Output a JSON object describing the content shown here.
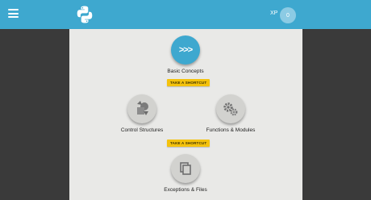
{
  "header": {
    "xp_label": "XP",
    "xp_value": "0"
  },
  "lessons": [
    {
      "label": "Basic Concepts",
      "icon": ">>>",
      "state": "active"
    },
    {
      "label": "Control Structures",
      "icon": "shapes-icon",
      "state": "locked"
    },
    {
      "label": "Functions & Modules",
      "icon": "gears-icon",
      "state": "locked"
    },
    {
      "label": "Exceptions & Files",
      "icon": "files-icon",
      "state": "locked"
    }
  ],
  "shortcuts": [
    {
      "label": "TAKE A SHORTCUT"
    },
    {
      "label": "TAKE A SHORTCUT"
    }
  ],
  "colors": {
    "header": "#3ea8cf",
    "panel": "#e9e9e7",
    "background": "#3a3a3a",
    "shortcut": "#f4c20d"
  }
}
